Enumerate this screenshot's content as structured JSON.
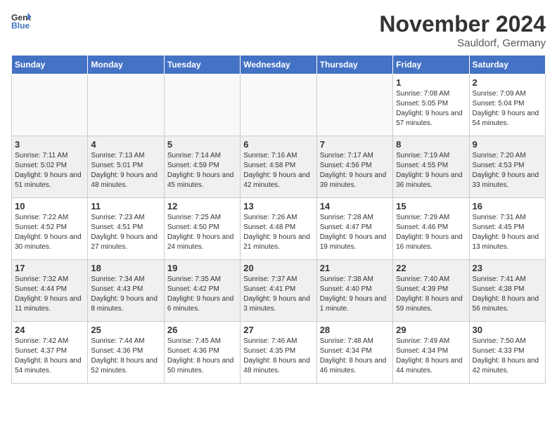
{
  "header": {
    "logo_general": "General",
    "logo_blue": "Blue",
    "month_title": "November 2024",
    "location": "Sauldorf, Germany"
  },
  "days_of_week": [
    "Sunday",
    "Monday",
    "Tuesday",
    "Wednesday",
    "Thursday",
    "Friday",
    "Saturday"
  ],
  "weeks": [
    [
      {
        "day": "",
        "detail": ""
      },
      {
        "day": "",
        "detail": ""
      },
      {
        "day": "",
        "detail": ""
      },
      {
        "day": "",
        "detail": ""
      },
      {
        "day": "",
        "detail": ""
      },
      {
        "day": "1",
        "detail": "Sunrise: 7:08 AM\nSunset: 5:05 PM\nDaylight: 9 hours and 57 minutes."
      },
      {
        "day": "2",
        "detail": "Sunrise: 7:09 AM\nSunset: 5:04 PM\nDaylight: 9 hours and 54 minutes."
      }
    ],
    [
      {
        "day": "3",
        "detail": "Sunrise: 7:11 AM\nSunset: 5:02 PM\nDaylight: 9 hours and 51 minutes."
      },
      {
        "day": "4",
        "detail": "Sunrise: 7:13 AM\nSunset: 5:01 PM\nDaylight: 9 hours and 48 minutes."
      },
      {
        "day": "5",
        "detail": "Sunrise: 7:14 AM\nSunset: 4:59 PM\nDaylight: 9 hours and 45 minutes."
      },
      {
        "day": "6",
        "detail": "Sunrise: 7:16 AM\nSunset: 4:58 PM\nDaylight: 9 hours and 42 minutes."
      },
      {
        "day": "7",
        "detail": "Sunrise: 7:17 AM\nSunset: 4:56 PM\nDaylight: 9 hours and 39 minutes."
      },
      {
        "day": "8",
        "detail": "Sunrise: 7:19 AM\nSunset: 4:55 PM\nDaylight: 9 hours and 36 minutes."
      },
      {
        "day": "9",
        "detail": "Sunrise: 7:20 AM\nSunset: 4:53 PM\nDaylight: 9 hours and 33 minutes."
      }
    ],
    [
      {
        "day": "10",
        "detail": "Sunrise: 7:22 AM\nSunset: 4:52 PM\nDaylight: 9 hours and 30 minutes."
      },
      {
        "day": "11",
        "detail": "Sunrise: 7:23 AM\nSunset: 4:51 PM\nDaylight: 9 hours and 27 minutes."
      },
      {
        "day": "12",
        "detail": "Sunrise: 7:25 AM\nSunset: 4:50 PM\nDaylight: 9 hours and 24 minutes."
      },
      {
        "day": "13",
        "detail": "Sunrise: 7:26 AM\nSunset: 4:48 PM\nDaylight: 9 hours and 21 minutes."
      },
      {
        "day": "14",
        "detail": "Sunrise: 7:28 AM\nSunset: 4:47 PM\nDaylight: 9 hours and 19 minutes."
      },
      {
        "day": "15",
        "detail": "Sunrise: 7:29 AM\nSunset: 4:46 PM\nDaylight: 9 hours and 16 minutes."
      },
      {
        "day": "16",
        "detail": "Sunrise: 7:31 AM\nSunset: 4:45 PM\nDaylight: 9 hours and 13 minutes."
      }
    ],
    [
      {
        "day": "17",
        "detail": "Sunrise: 7:32 AM\nSunset: 4:44 PM\nDaylight: 9 hours and 11 minutes."
      },
      {
        "day": "18",
        "detail": "Sunrise: 7:34 AM\nSunset: 4:43 PM\nDaylight: 9 hours and 8 minutes."
      },
      {
        "day": "19",
        "detail": "Sunrise: 7:35 AM\nSunset: 4:42 PM\nDaylight: 9 hours and 6 minutes."
      },
      {
        "day": "20",
        "detail": "Sunrise: 7:37 AM\nSunset: 4:41 PM\nDaylight: 9 hours and 3 minutes."
      },
      {
        "day": "21",
        "detail": "Sunrise: 7:38 AM\nSunset: 4:40 PM\nDaylight: 9 hours and 1 minute."
      },
      {
        "day": "22",
        "detail": "Sunrise: 7:40 AM\nSunset: 4:39 PM\nDaylight: 8 hours and 59 minutes."
      },
      {
        "day": "23",
        "detail": "Sunrise: 7:41 AM\nSunset: 4:38 PM\nDaylight: 8 hours and 56 minutes."
      }
    ],
    [
      {
        "day": "24",
        "detail": "Sunrise: 7:42 AM\nSunset: 4:37 PM\nDaylight: 8 hours and 54 minutes."
      },
      {
        "day": "25",
        "detail": "Sunrise: 7:44 AM\nSunset: 4:36 PM\nDaylight: 8 hours and 52 minutes."
      },
      {
        "day": "26",
        "detail": "Sunrise: 7:45 AM\nSunset: 4:36 PM\nDaylight: 8 hours and 50 minutes."
      },
      {
        "day": "27",
        "detail": "Sunrise: 7:46 AM\nSunset: 4:35 PM\nDaylight: 8 hours and 48 minutes."
      },
      {
        "day": "28",
        "detail": "Sunrise: 7:48 AM\nSunset: 4:34 PM\nDaylight: 8 hours and 46 minutes."
      },
      {
        "day": "29",
        "detail": "Sunrise: 7:49 AM\nSunset: 4:34 PM\nDaylight: 8 hours and 44 minutes."
      },
      {
        "day": "30",
        "detail": "Sunrise: 7:50 AM\nSunset: 4:33 PM\nDaylight: 8 hours and 42 minutes."
      }
    ]
  ]
}
